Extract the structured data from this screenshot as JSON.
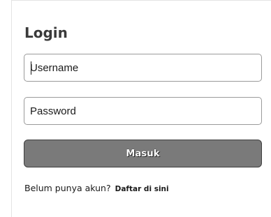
{
  "login": {
    "title": "Login",
    "username_placeholder": "Username",
    "password_placeholder": "Password",
    "submit_label": "Masuk",
    "signup_prompt": "Belum punya akun?",
    "signup_link": "Daftar di sini"
  }
}
